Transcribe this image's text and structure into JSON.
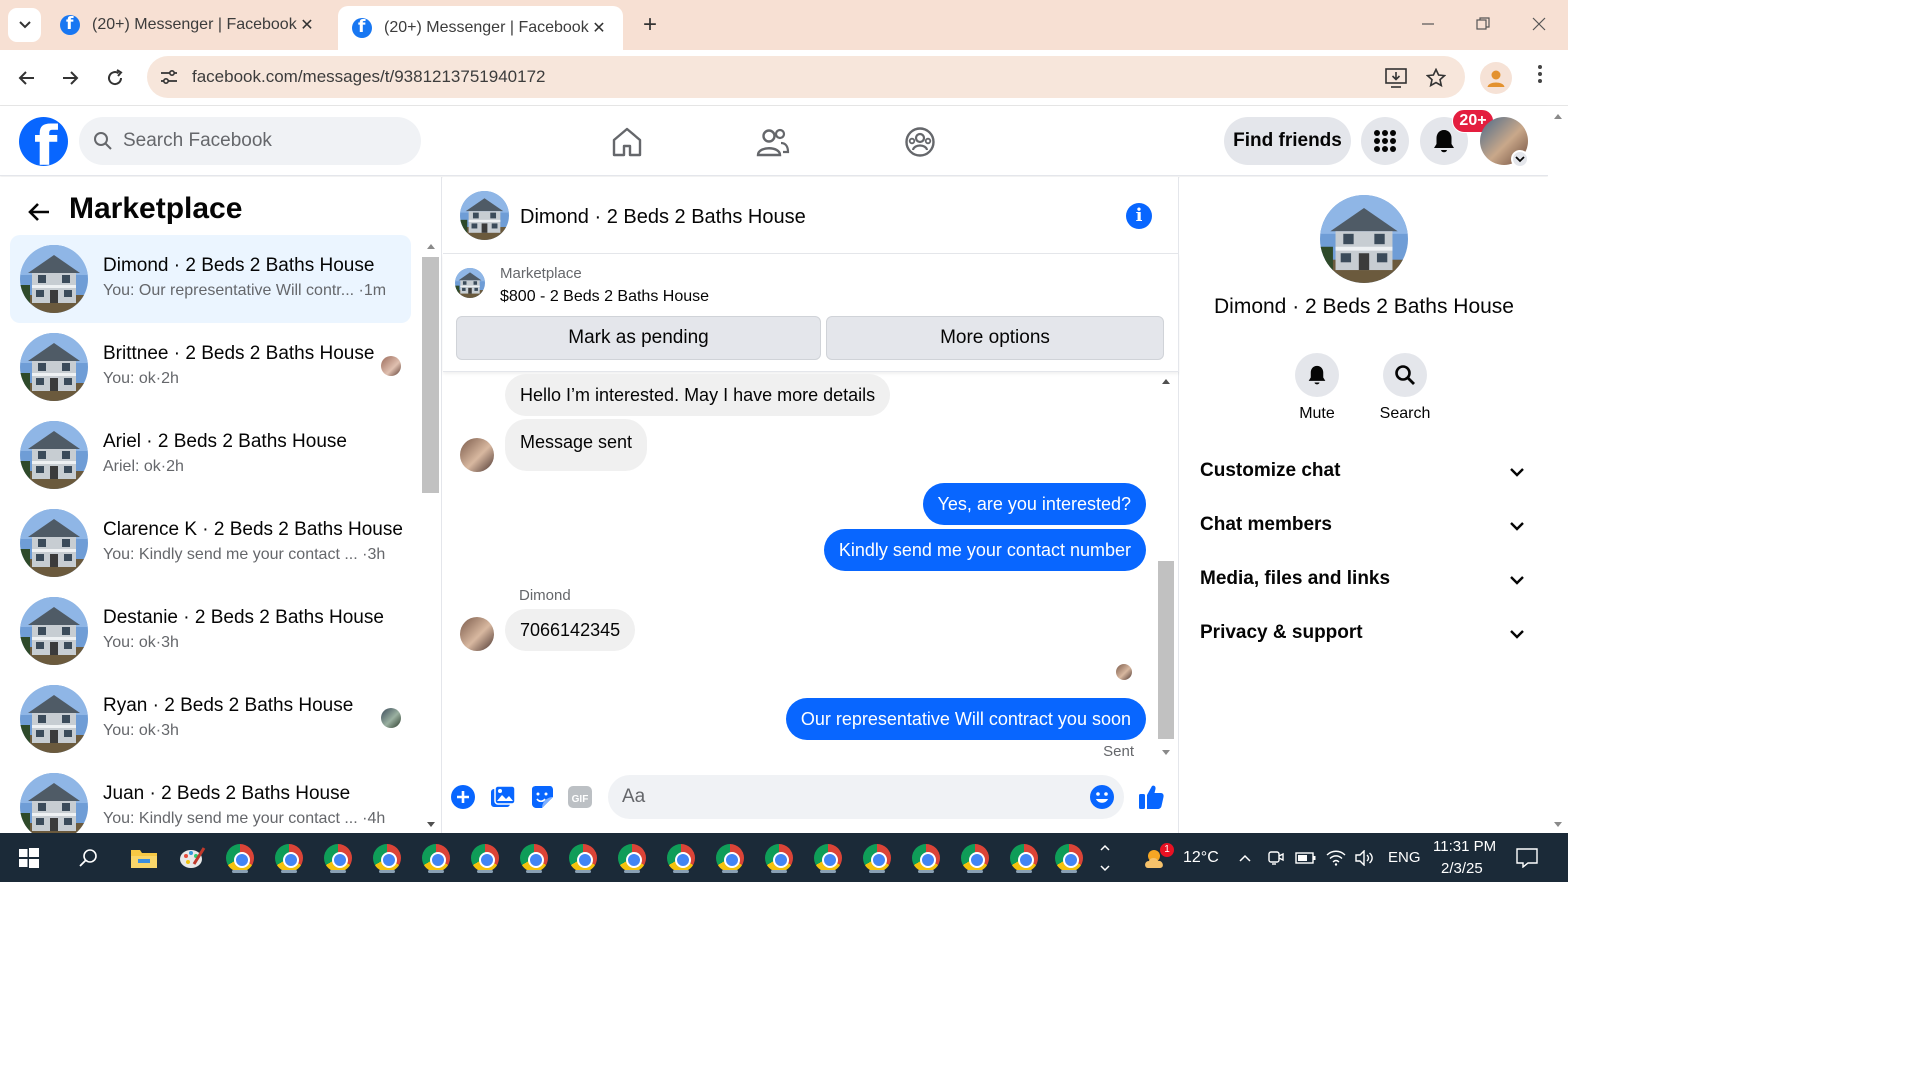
{
  "browser": {
    "tabs": [
      {
        "title": "(20+) Messenger | Facebook",
        "close": "✕"
      },
      {
        "title": "(20+) Messenger | Facebook",
        "close": "✕"
      }
    ],
    "new_tab": "+",
    "url": "facebook.com/messages/t/9381213751940172"
  },
  "fb": {
    "search_placeholder": "Search Facebook",
    "find_friends": "Find friends",
    "notification_badge": "20+",
    "brand_color": "#0866ff"
  },
  "left_panel": {
    "title": "Marketplace",
    "conversations": [
      {
        "name": "Dimond · 2 Beds 2 Baths House",
        "preview": "You: Our representative Will contr... ·1m"
      },
      {
        "name": "Brittnee · 2 Beds 2 Baths House",
        "preview": "You: ok·2h"
      },
      {
        "name": "Ariel · 2 Beds 2 Baths House",
        "preview": "Ariel: ok·2h"
      },
      {
        "name": "Clarence K · 2 Beds 2 Baths House",
        "preview": "You: Kindly send me your contact ... ·3h"
      },
      {
        "name": "Destanie · 2 Beds 2 Baths House",
        "preview": "You: ok·3h"
      },
      {
        "name": "Ryan · 2 Beds 2 Baths House",
        "preview": "You: ok·3h"
      },
      {
        "name": "Juan · 2 Beds 2 Baths House",
        "preview": "You: Kindly send me your contact ... ·4h"
      }
    ]
  },
  "chat": {
    "header_name": "Dimond · 2 Beds 2 Baths House",
    "info_glyph": "i",
    "marketplace_label": "Marketplace",
    "listing_title": "$800 - 2 Beds 2 Baths House",
    "mark_pending": "Mark as pending",
    "more_options": "More options",
    "messages": {
      "m1": "Hello I’m interested. May I have more details",
      "m2": "Message sent",
      "m3": "Yes, are you interested?",
      "m4": "Kindly send me your contact number",
      "sender": "Dimond",
      "m5": "7066142345",
      "m6": "Our representative Will contract you soon",
      "status": "Sent"
    },
    "composer_placeholder": "Aa"
  },
  "right_panel": {
    "name": "Dimond · 2 Beds 2 Baths House",
    "mute": "Mute",
    "search": "Search",
    "sections": [
      "Customize chat",
      "Chat members",
      "Media, files and links",
      "Privacy & support"
    ]
  },
  "taskbar": {
    "temperature": "12°C",
    "language": "ENG",
    "time": "11:31 PM",
    "date": "2/3/25",
    "weather_badge": "1"
  }
}
